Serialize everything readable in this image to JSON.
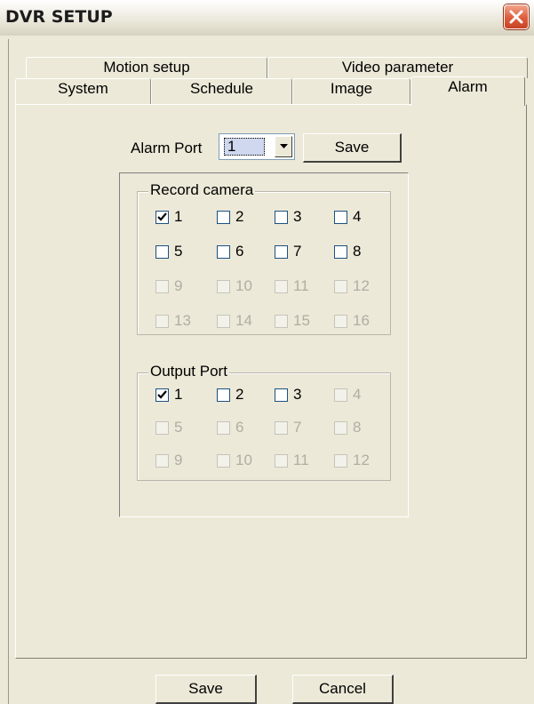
{
  "window": {
    "title": "DVR SETUP"
  },
  "tabs": {
    "row1": [
      "Motion setup",
      "Video parameter"
    ],
    "row2": [
      "System",
      "Schedule",
      "Image",
      "Alarm"
    ],
    "selected": "Alarm"
  },
  "alarm": {
    "port_label": "Alarm Port",
    "port_value": "1",
    "save_label": "Save"
  },
  "record_camera": {
    "title": "Record camera",
    "items": [
      {
        "label": "1",
        "checked": true,
        "enabled": true
      },
      {
        "label": "2",
        "checked": false,
        "enabled": true
      },
      {
        "label": "3",
        "checked": false,
        "enabled": true
      },
      {
        "label": "4",
        "checked": false,
        "enabled": true
      },
      {
        "label": "5",
        "checked": false,
        "enabled": true
      },
      {
        "label": "6",
        "checked": false,
        "enabled": true
      },
      {
        "label": "7",
        "checked": false,
        "enabled": true
      },
      {
        "label": "8",
        "checked": false,
        "enabled": true
      },
      {
        "label": "9",
        "checked": false,
        "enabled": false
      },
      {
        "label": "10",
        "checked": false,
        "enabled": false
      },
      {
        "label": "11",
        "checked": false,
        "enabled": false
      },
      {
        "label": "12",
        "checked": false,
        "enabled": false
      },
      {
        "label": "13",
        "checked": false,
        "enabled": false
      },
      {
        "label": "14",
        "checked": false,
        "enabled": false
      },
      {
        "label": "15",
        "checked": false,
        "enabled": false
      },
      {
        "label": "16",
        "checked": false,
        "enabled": false
      }
    ]
  },
  "output_port": {
    "title": "Output Port",
    "items": [
      {
        "label": "1",
        "checked": true,
        "enabled": true
      },
      {
        "label": "2",
        "checked": false,
        "enabled": true
      },
      {
        "label": "3",
        "checked": false,
        "enabled": true
      },
      {
        "label": "4",
        "checked": false,
        "enabled": false
      },
      {
        "label": "5",
        "checked": false,
        "enabled": false
      },
      {
        "label": "6",
        "checked": false,
        "enabled": false
      },
      {
        "label": "7",
        "checked": false,
        "enabled": false
      },
      {
        "label": "8",
        "checked": false,
        "enabled": false
      },
      {
        "label": "9",
        "checked": false,
        "enabled": false
      },
      {
        "label": "10",
        "checked": false,
        "enabled": false
      },
      {
        "label": "11",
        "checked": false,
        "enabled": false
      },
      {
        "label": "12",
        "checked": false,
        "enabled": false
      }
    ]
  },
  "footer": {
    "save_label": "Save",
    "cancel_label": "Cancel"
  },
  "colors": {
    "face": "#ece9d8",
    "close_button": "#dd5c3a"
  },
  "icons": {
    "close": "close-icon",
    "dropdown": "chevron-down-icon",
    "check": "checkmark-icon"
  }
}
